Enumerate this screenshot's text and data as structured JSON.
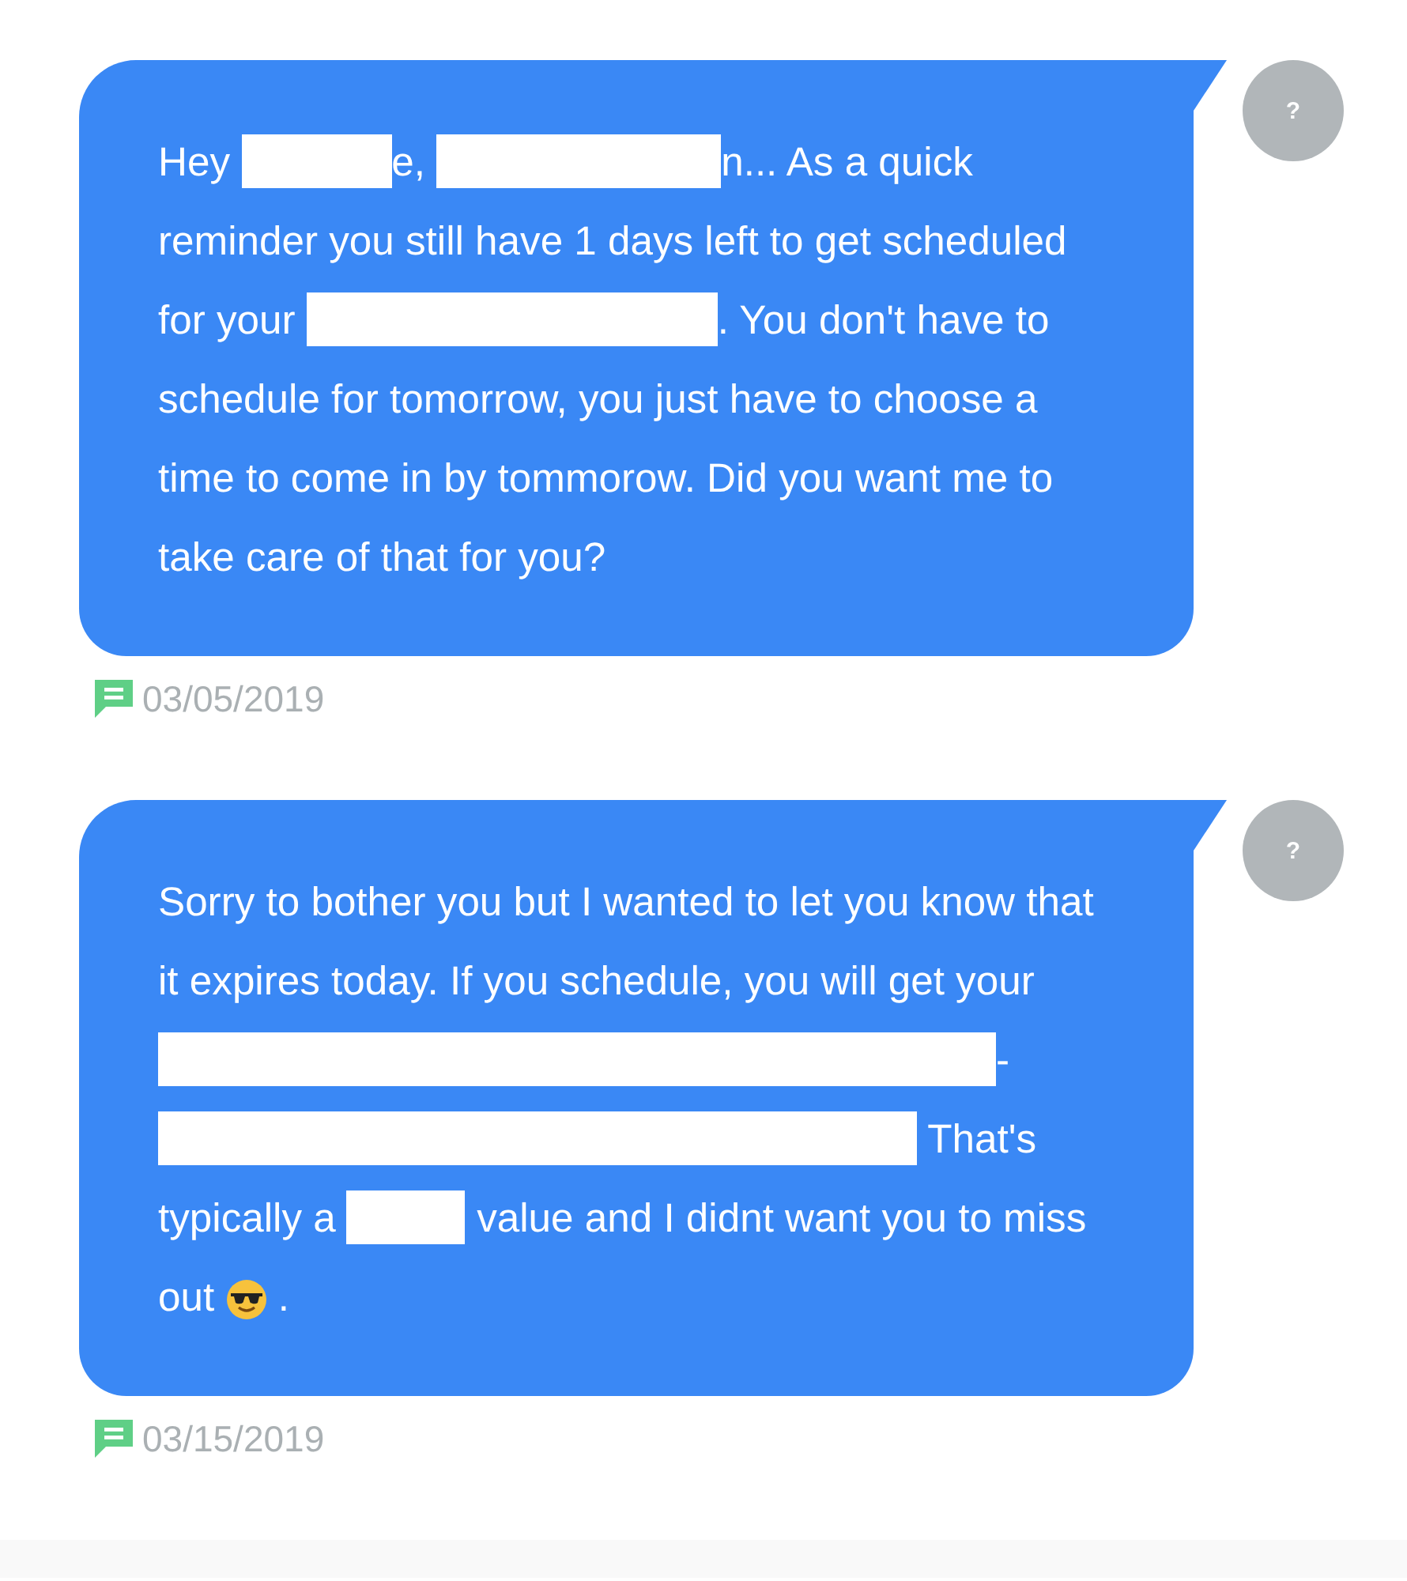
{
  "messages": [
    {
      "avatar": "?",
      "date": "03/05/2019",
      "segments": [
        {
          "kind": "text",
          "text": "Hey "
        },
        {
          "kind": "redacted"
        },
        {
          "kind": "text",
          "text": "e, "
        },
        {
          "kind": "redacted"
        },
        {
          "kind": "text",
          "text": "n... As a quick reminder you still have 1 days left to get scheduled for your "
        },
        {
          "kind": "redacted"
        },
        {
          "kind": "text",
          "text": ". You don't have to schedule for tomorrow, you just have to choose a time to come in by tommorow. Did you want me to take care of that for you?"
        }
      ]
    },
    {
      "avatar": "?",
      "date": "03/15/2019",
      "segments": [
        {
          "kind": "text",
          "text": "Sorry to bother you but I wanted to let you know that it expires today. If you schedule, you will get your "
        },
        {
          "kind": "redacted"
        },
        {
          "kind": "text",
          "text": "-"
        },
        {
          "kind": "redacted"
        },
        {
          "kind": "text",
          "text": " That's typically a "
        },
        {
          "kind": "redacted"
        },
        {
          "kind": "text",
          "text": " value and I didnt want you to miss out "
        },
        {
          "kind": "emoji"
        },
        {
          "kind": "text",
          "text": " ."
        }
      ]
    }
  ]
}
